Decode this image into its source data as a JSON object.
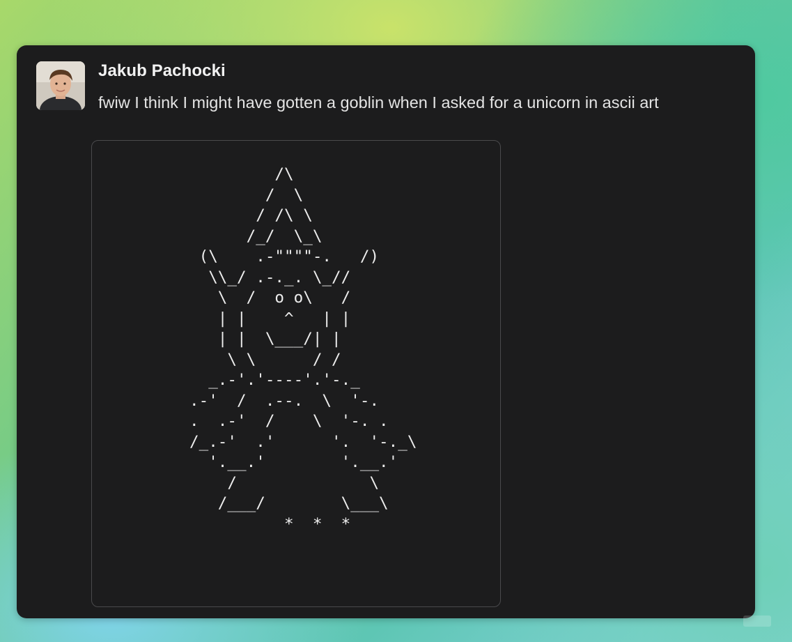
{
  "message": {
    "author": "Jakub Pachocki",
    "text": "fwiw I think I might have gotten a goblin when I asked for a unicorn in ascii art",
    "avatar_icon": "user-avatar-photo"
  },
  "attachment": {
    "ascii_art": "         /\\\n        /  \\\n       / /\\ \\\n      /_/  \\_\\\n (\\    .-\"\"\"\"-.   /)\n  \\\\_/ .-._. \\_//\n   \\  /  o o\\   /\n   | |    ^   | |\n   | |  \\___/| |\n    \\ \\      / /\n  _.-'.'----'.'-._\n.-'  /  .--.  \\  '-.\n.  .-'  /    \\  '-. .\n/_.-'  .'      '.  '-._\\\n  '.__.'        '.__.'\n    /              \\\n   /___/        \\___\\\n          *  *  *"
  },
  "colors": {
    "card_bg": "#1c1c1d",
    "text_primary": "#f2f2f2",
    "frame_border": "#4a4a4c"
  }
}
